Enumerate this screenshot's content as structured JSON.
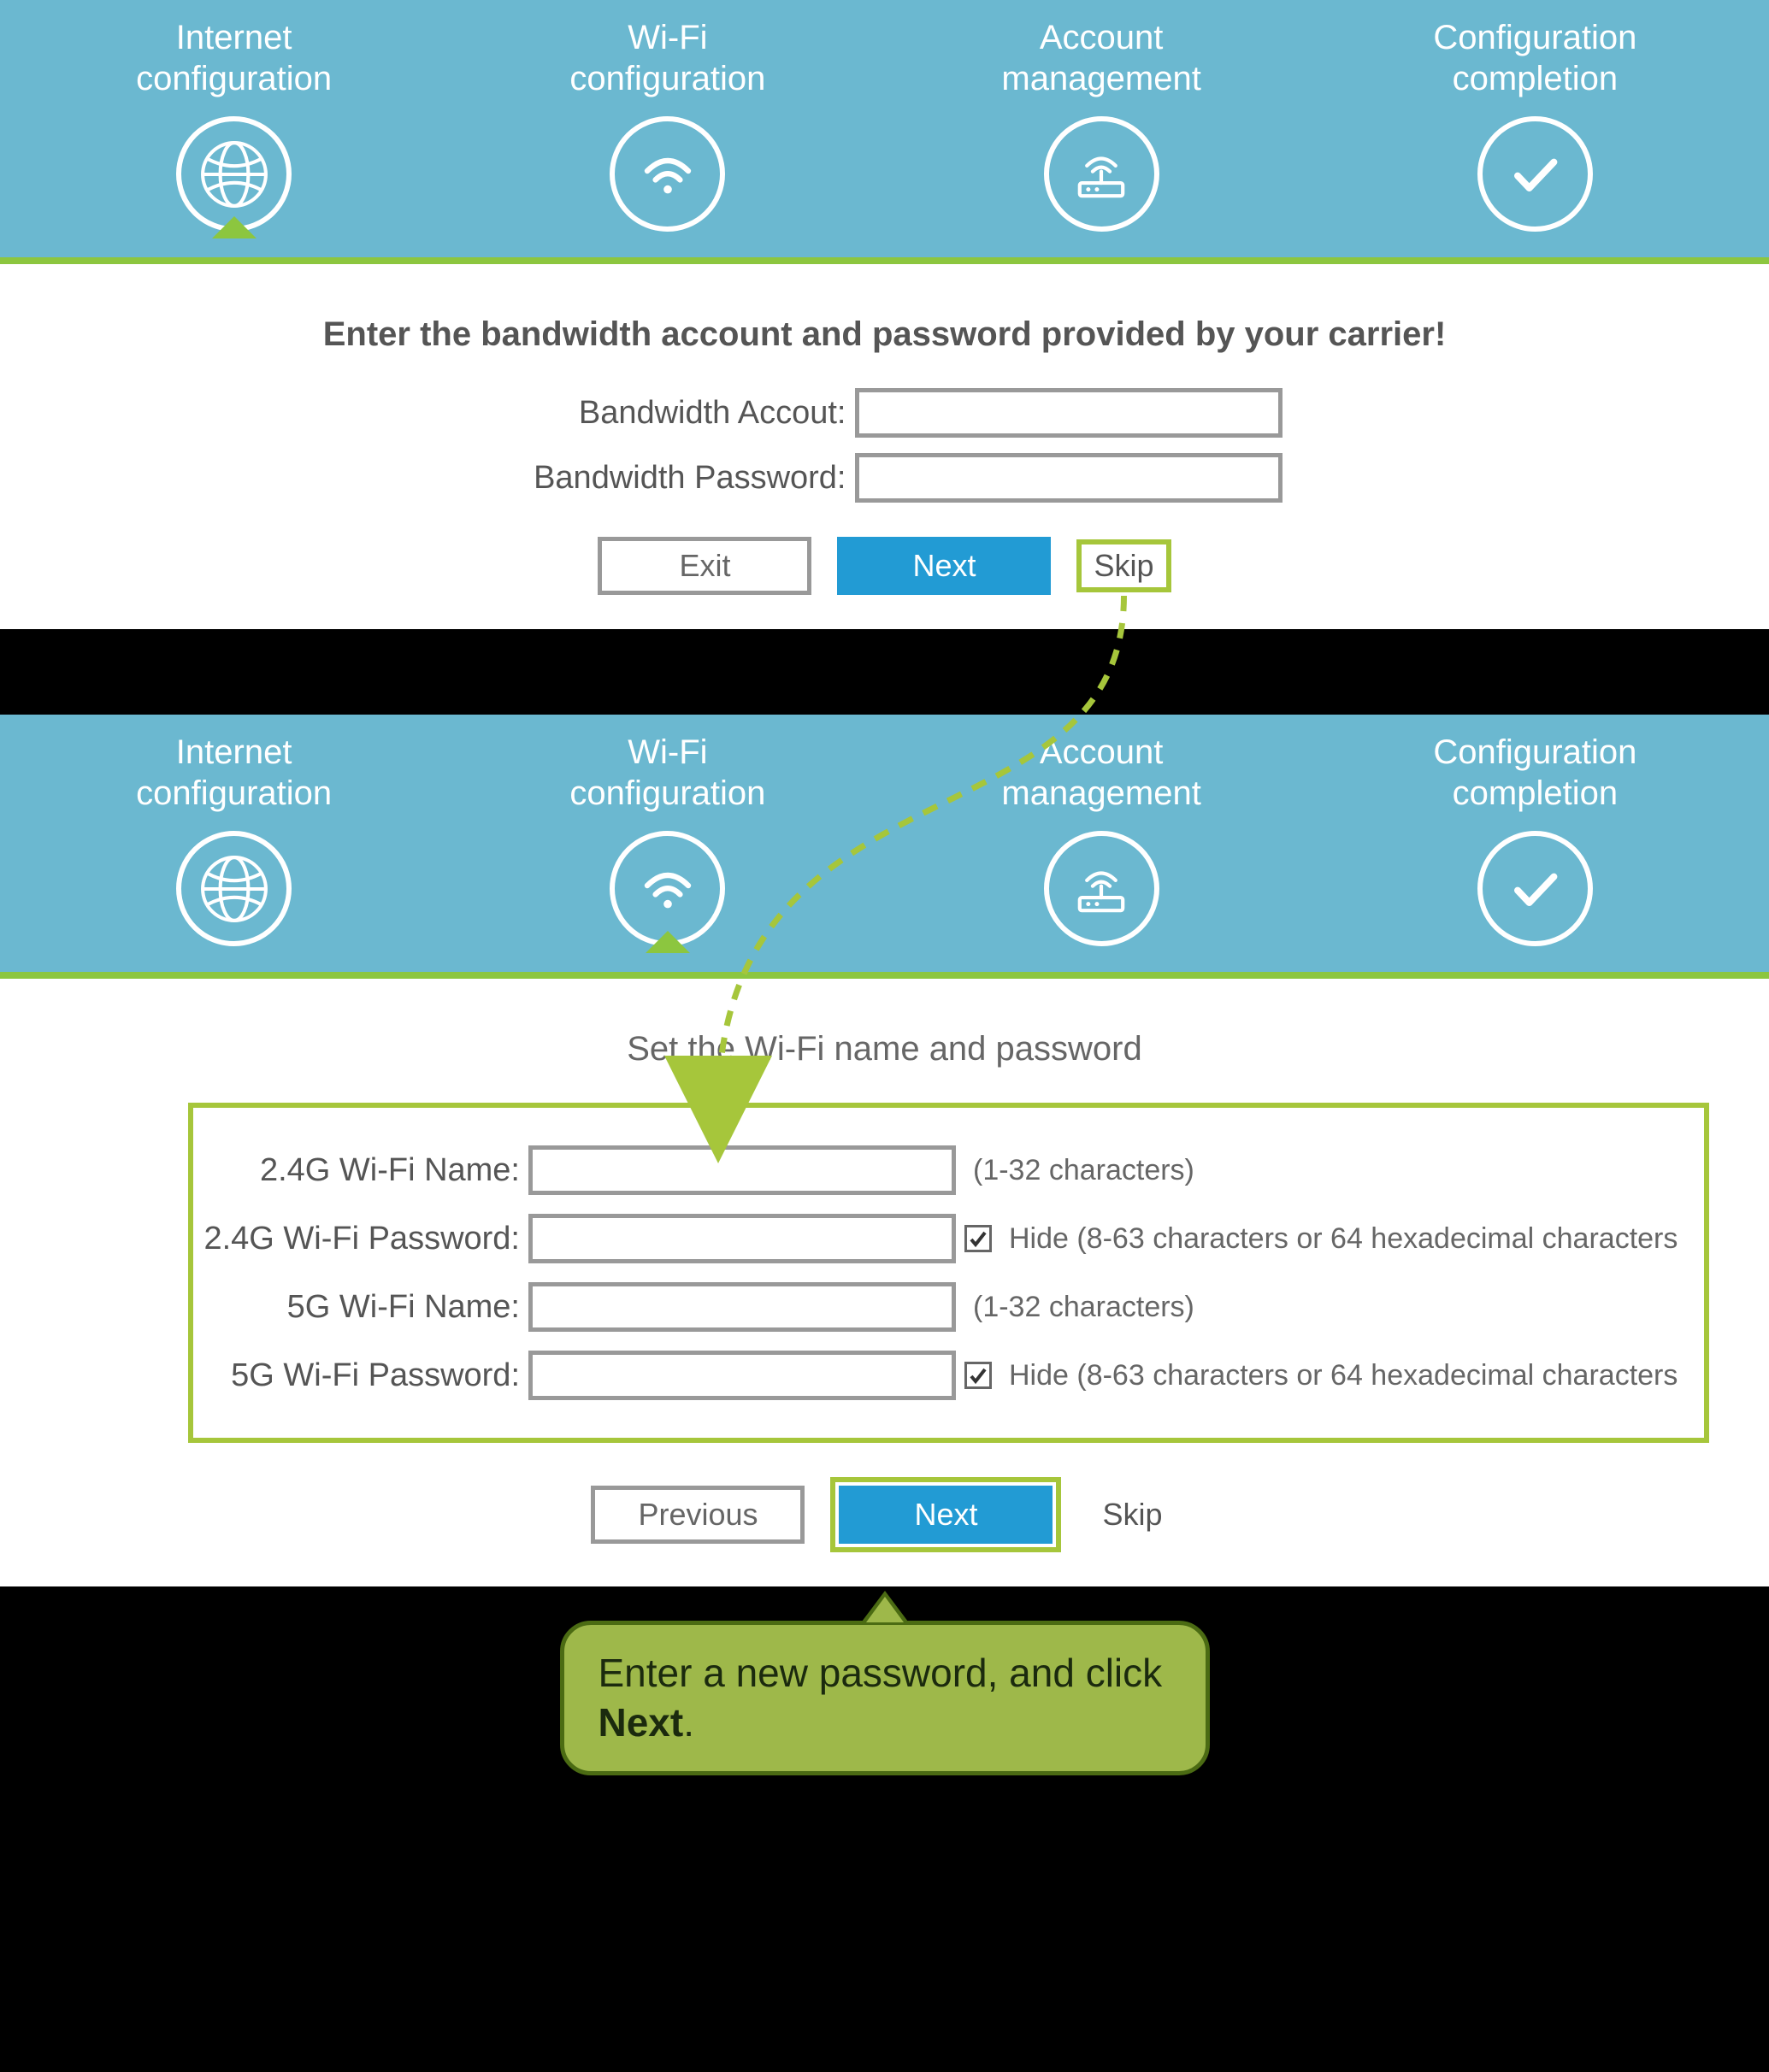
{
  "colors": {
    "header": "#6bb8d0",
    "accent": "#8cc63f",
    "primary": "#229bd4"
  },
  "steps": [
    {
      "line1": "Internet",
      "line2": "configuration"
    },
    {
      "line1": "Wi-Fi",
      "line2": "configuration"
    },
    {
      "line1": "Account",
      "line2": "management"
    },
    {
      "line1": "Configuration",
      "line2": "completion"
    }
  ],
  "panel1": {
    "heading": "Enter the bandwidth account and password provided by your carrier!",
    "fields": {
      "account_label": "Bandwidth Accout:",
      "password_label": "Bandwidth Password:"
    },
    "buttons": {
      "exit": "Exit",
      "next": "Next",
      "skip": "Skip"
    }
  },
  "panel2": {
    "heading": "Set the Wi-Fi name and password",
    "fields": {
      "name24_label": "2.4G Wi-Fi Name:",
      "pw24_label": "2.4G Wi-Fi Password:",
      "name5_label": "5G Wi-Fi Name:",
      "pw5_label": "5G Wi-Fi Password:",
      "name_hint": "(1-32 characters)",
      "pw_hint": "Hide (8-63 characters or 64 hexadecimal characters",
      "hide_checked": true
    },
    "buttons": {
      "previous": "Previous",
      "next": "Next",
      "skip": "Skip"
    }
  },
  "callout": {
    "text_pre": "Enter a new password, and click ",
    "text_bold": "Next",
    "text_post": "."
  }
}
